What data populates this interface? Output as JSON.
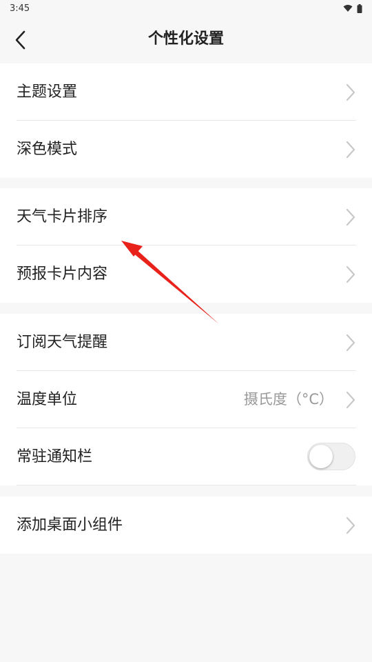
{
  "status_bar": {
    "time": "3:45",
    "wifi_icon": "wifi-icon",
    "battery_icon": "battery-icon"
  },
  "header": {
    "title": "个性化设置",
    "back_icon": "chevron-left-icon"
  },
  "groups": [
    {
      "items": [
        {
          "label": "主题设置"
        },
        {
          "label": "深色模式"
        }
      ]
    },
    {
      "items": [
        {
          "label": "天气卡片排序"
        },
        {
          "label": "预报卡片内容"
        }
      ]
    },
    {
      "items": [
        {
          "label": "订阅天气提醒"
        },
        {
          "label": "温度单位",
          "value": "摄氏度（°C）"
        },
        {
          "label": "常驻通知栏",
          "toggle_on": false
        }
      ]
    },
    {
      "items": [
        {
          "label": "添加桌面小组件"
        }
      ]
    }
  ],
  "colors": {
    "background": "#f7f7f7",
    "card": "#ffffff",
    "annotation_arrow": "#e8221b",
    "chevron": "#c8c8c8",
    "value_text": "#999999"
  }
}
